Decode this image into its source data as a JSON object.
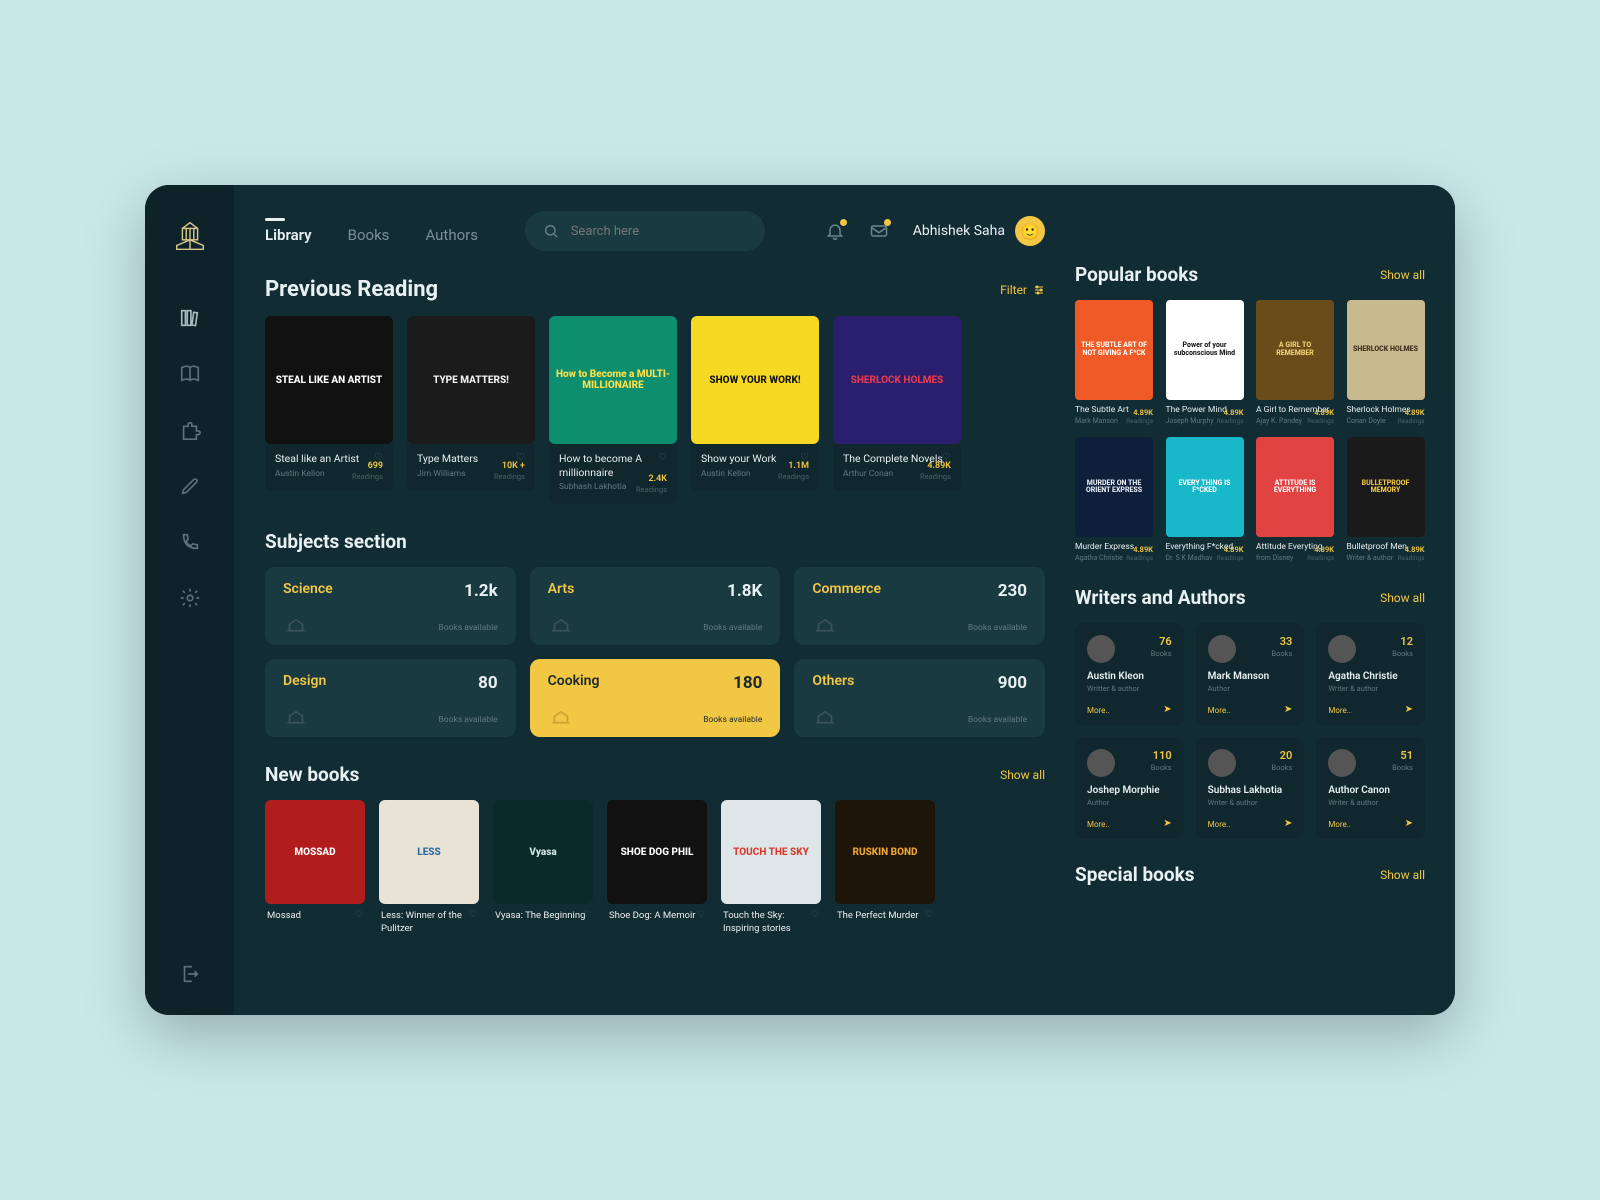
{
  "user": {
    "name": "Abhishek Saha"
  },
  "tabs": [
    "Library",
    "Books",
    "Authors"
  ],
  "search": {
    "placeholder": "Search here"
  },
  "filter_label": "Filter",
  "showall_label": "Show all",
  "sections": {
    "previous": "Previous Reading",
    "subjects": "Subjects section",
    "newbooks": "New books",
    "popular": "Popular books",
    "writers": "Writers and Authors",
    "special": "Special books"
  },
  "previous": [
    {
      "title": "Steal like an Artist",
      "author": "Austin Kellon",
      "count": "699",
      "sub": "Readings",
      "coverText": "STEAL LIKE AN ARTIST",
      "bg": "#111",
      "fg": "#fff"
    },
    {
      "title": "Type Matters",
      "author": "Jim Williams",
      "count": "10K +",
      "sub": "Readings",
      "coverText": "TYPE MATTERS!",
      "bg": "#1b1b1b",
      "fg": "#f1f1f1"
    },
    {
      "title": "How to become A millionnaire",
      "author": "Subhash Lakhotia",
      "count": "2.4K",
      "sub": "Readings",
      "coverText": "How to Become a MULTI-MILLIONAIRE",
      "bg": "#0d8f6f",
      "fg": "#ffe14a"
    },
    {
      "title": "Show your Work",
      "author": "Austin Kellon",
      "count": "1.1M",
      "sub": "Readings",
      "coverText": "SHOW YOUR WORK!",
      "bg": "#f7d924",
      "fg": "#111"
    },
    {
      "title": "The Complete Novels",
      "author": "Arthur Conan",
      "count": "4.89K",
      "sub": "Readings",
      "coverText": "SHERLOCK HOLMES",
      "bg": "#2a1f6e",
      "fg": "#e63950"
    }
  ],
  "subjects": [
    {
      "name": "Science",
      "count": "1.2k",
      "avail": "Books available"
    },
    {
      "name": "Arts",
      "count": "1.8K",
      "avail": "Books available"
    },
    {
      "name": "Commerce",
      "count": "230",
      "avail": "Books available"
    },
    {
      "name": "Design",
      "count": "80",
      "avail": "Books available"
    },
    {
      "name": "Cooking",
      "count": "180",
      "avail": "Books available",
      "active": true
    },
    {
      "name": "Others",
      "count": "900",
      "avail": "Books available"
    }
  ],
  "newbooks": [
    {
      "title": "Mossad",
      "bg": "#b11d1d",
      "fg": "#fff",
      "coverText": "MOSSAD"
    },
    {
      "title": "Less: Winner of the Pulitzer",
      "bg": "#e9e3d6",
      "fg": "#2c6aa0",
      "coverText": "LESS"
    },
    {
      "title": "Vyasa: The Beginning",
      "bg": "#0a2a2a",
      "fg": "#d9e8e8",
      "coverText": "Vyasa"
    },
    {
      "title": "Shoe Dog: A Memoir",
      "bg": "#111",
      "fg": "#fff",
      "coverText": "SHOE DOG PHIL"
    },
    {
      "title": "Touch the Sky: Inspiring stories",
      "bg": "#dfe6ea",
      "fg": "#d63b2e",
      "coverText": "TOUCH THE SKY"
    },
    {
      "title": "The Perfect Murder",
      "bg": "#1c1508",
      "fg": "#f0a62f",
      "coverText": "RUSKIN BOND"
    }
  ],
  "popular": [
    {
      "title": "The Subtle Art",
      "author": "Mark Manson",
      "count": "4.89K",
      "sub": "Readings",
      "bg": "#ef5a26",
      "fg": "#fff",
      "coverText": "THE SUBTLE ART OF NOT GIVING A F*CK"
    },
    {
      "title": "The Power Mind",
      "author": "Joseph Murphy",
      "count": "4.89K",
      "sub": "Readings",
      "bg": "#fff",
      "fg": "#1b1b1b",
      "coverText": "Power of your subconscious Mind"
    },
    {
      "title": "A Girl to Remember",
      "author": "Ajay K. Pandey",
      "count": "4.89K",
      "sub": "Readings",
      "bg": "#6b4b1a",
      "fg": "#f3d37a",
      "coverText": "A GIRL TO REMEMBER"
    },
    {
      "title": "Sherlock Holmes",
      "author": "Conan Doyle",
      "count": "4.89K",
      "sub": "Readings",
      "bg": "#c8b98e",
      "fg": "#3a2c1a",
      "coverText": "SHERLOCK HOLMES"
    },
    {
      "title": "Murder Express",
      "author": "Agatha Christie",
      "count": "4.89K",
      "sub": "Readings",
      "bg": "#0d1f3a",
      "fg": "#e8eef5",
      "coverText": "MURDER ON THE ORIENT EXPRESS"
    },
    {
      "title": "Everything F*cked",
      "author": "Dr. S K Madhav",
      "count": "4.89K",
      "sub": "Readings",
      "bg": "#18b7c9",
      "fg": "#fff",
      "coverText": "EVERY THING IS F*CKED"
    },
    {
      "title": "Attitude Everyting",
      "author": "from Disney",
      "count": "4.89K",
      "sub": "Readings",
      "bg": "#e14242",
      "fg": "#fff",
      "coverText": "ATTITUDE IS EVERYTHING"
    },
    {
      "title": "Bulletproof Men",
      "author": "Writer & author",
      "count": "4.89K",
      "sub": "Readings",
      "bg": "#1a1a1a",
      "fg": "#f2c744",
      "coverText": "BULLETPROOF MEMORY"
    }
  ],
  "authors": [
    {
      "name": "Austin Kleon",
      "role": "Writter & author",
      "books": "76",
      "bookslabel": "Books",
      "more": "More.."
    },
    {
      "name": "Mark Manson",
      "role": "Author",
      "books": "33",
      "bookslabel": "Books",
      "more": "More.."
    },
    {
      "name": "Agatha Christie",
      "role": "Writer & author",
      "books": "12",
      "bookslabel": "Books",
      "more": "More.."
    },
    {
      "name": "Joshep Morphie",
      "role": "Author",
      "books": "110",
      "bookslabel": "Books",
      "more": "More.."
    },
    {
      "name": "Subhas Lakhotia",
      "role": "Writer & author",
      "books": "20",
      "bookslabel": "Books",
      "more": "More.."
    },
    {
      "name": "Author Canon",
      "role": "Writer & author",
      "books": "51",
      "bookslabel": "Books",
      "more": "More.."
    }
  ]
}
